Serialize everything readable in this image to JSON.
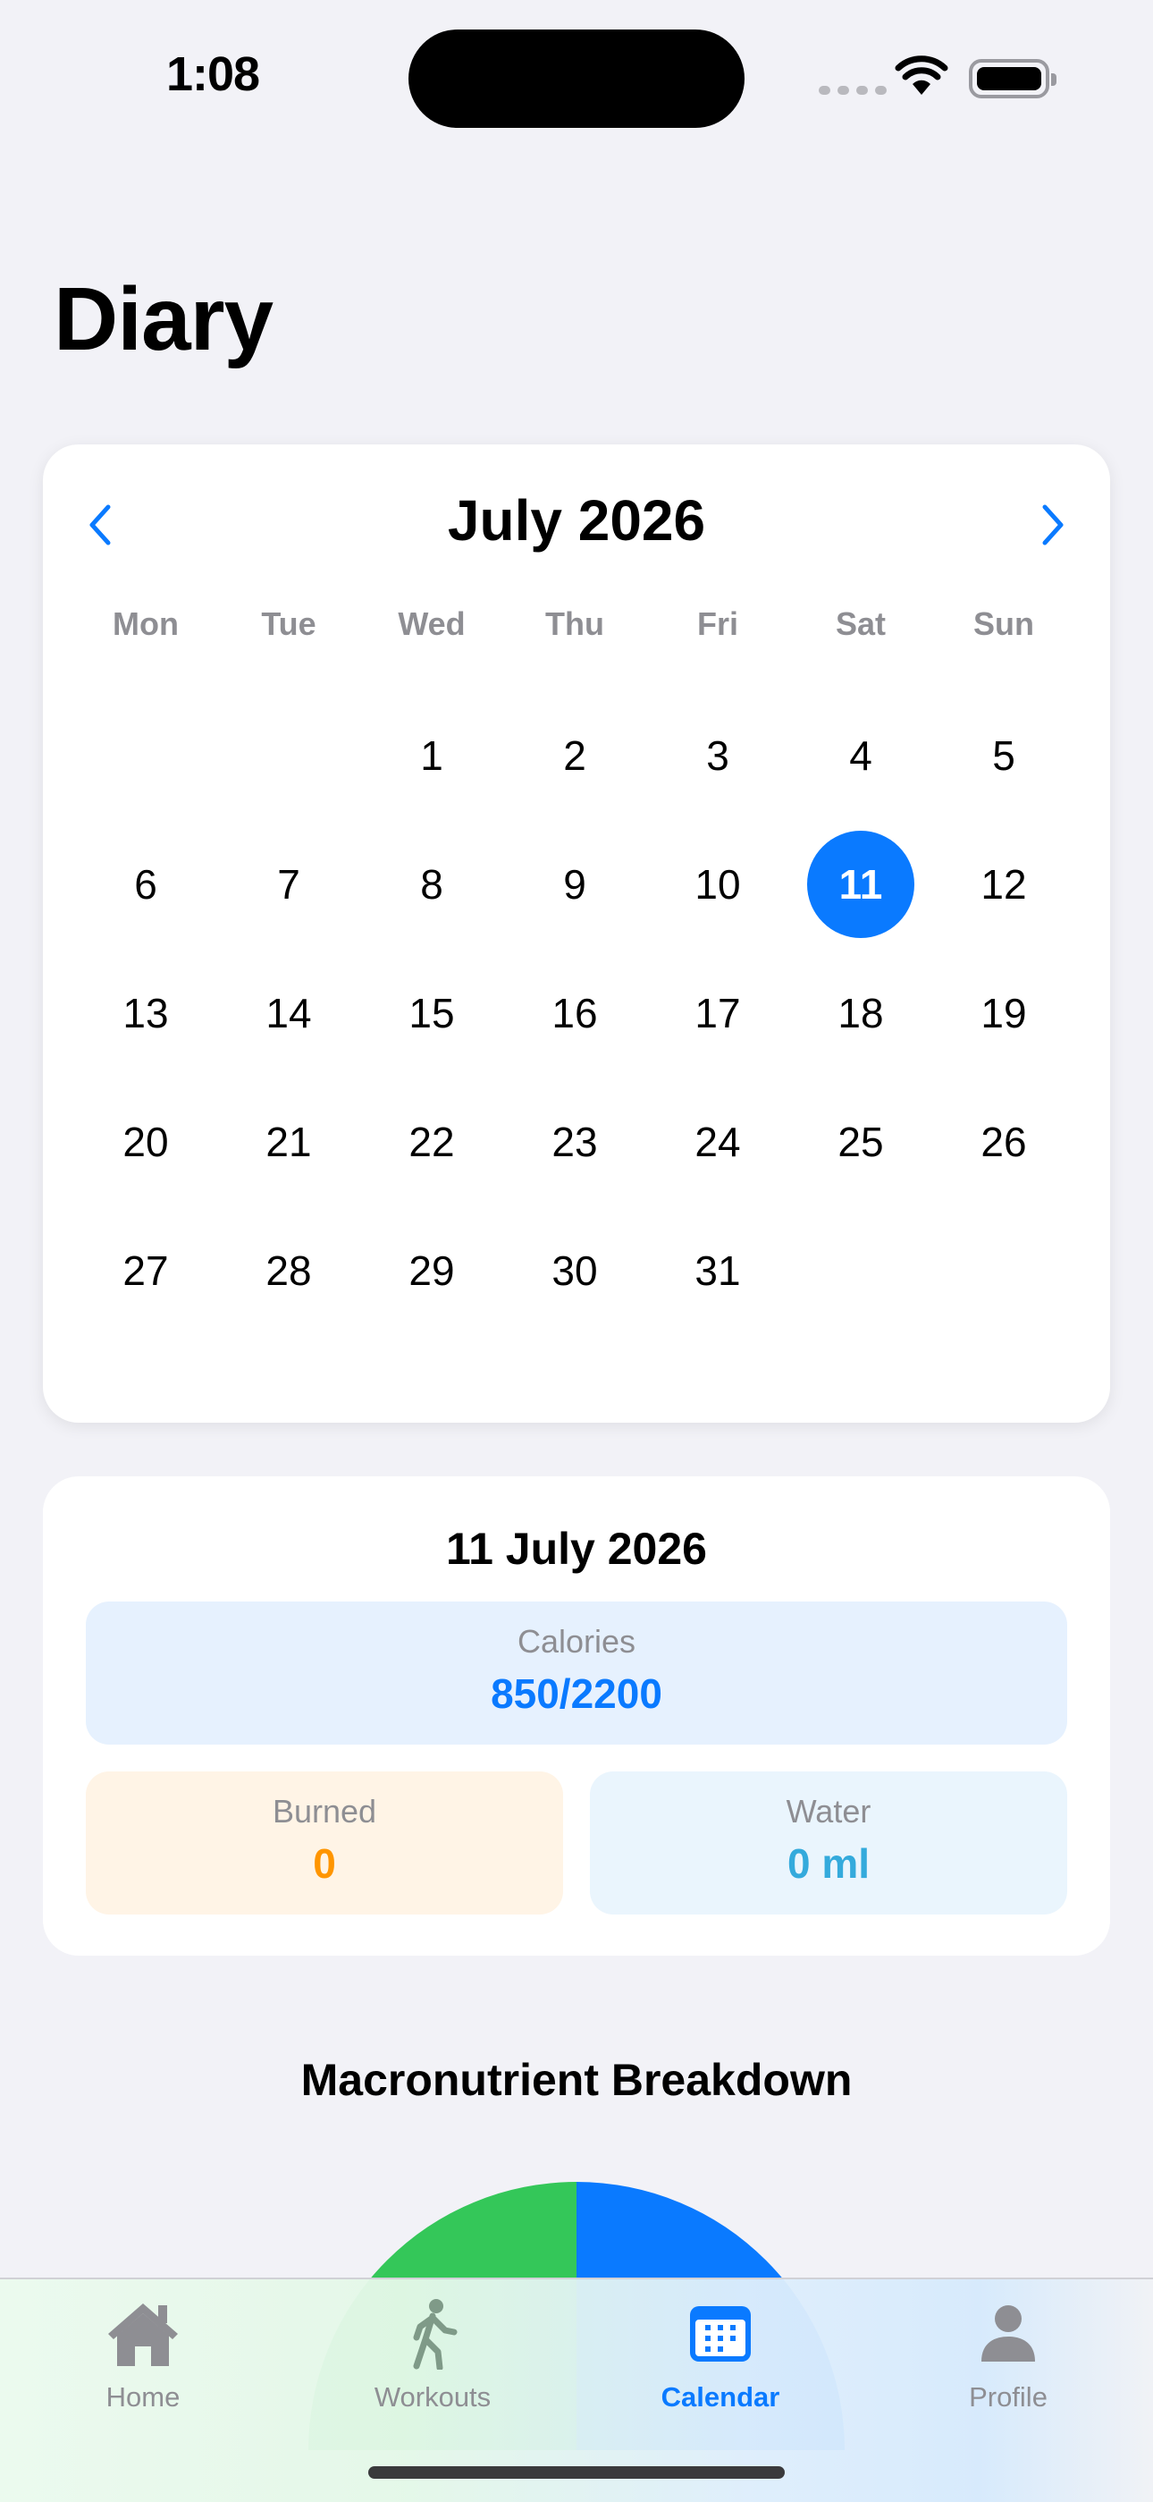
{
  "status_bar": {
    "time": "1:08"
  },
  "header": {
    "title": "Diary"
  },
  "calendar": {
    "month_label": "July 2026",
    "weekdays": [
      "Mon",
      "Tue",
      "Wed",
      "Thu",
      "Fri",
      "Sat",
      "Sun"
    ],
    "first_weekday_index": 2,
    "days_in_month": 31,
    "selected_day": 11,
    "accent_color": "#0a7aff"
  },
  "summary": {
    "date_label": "11 July 2026",
    "calories": {
      "label": "Calories",
      "value": "850/2200"
    },
    "burned": {
      "label": "Burned",
      "value": "0"
    },
    "water": {
      "label": "Water",
      "value": "0 ml"
    }
  },
  "macros": {
    "title": "Macronutrient Breakdown",
    "slice_colors": [
      "#34c759",
      "#0a7aff"
    ]
  },
  "tab_bar": {
    "tabs": [
      {
        "label": "Home",
        "icon": "house-icon",
        "active": false
      },
      {
        "label": "Workouts",
        "icon": "figure-walk-icon",
        "active": false
      },
      {
        "label": "Calendar",
        "icon": "calendar-icon",
        "active": true
      },
      {
        "label": "Profile",
        "icon": "person-icon",
        "active": false
      }
    ]
  }
}
